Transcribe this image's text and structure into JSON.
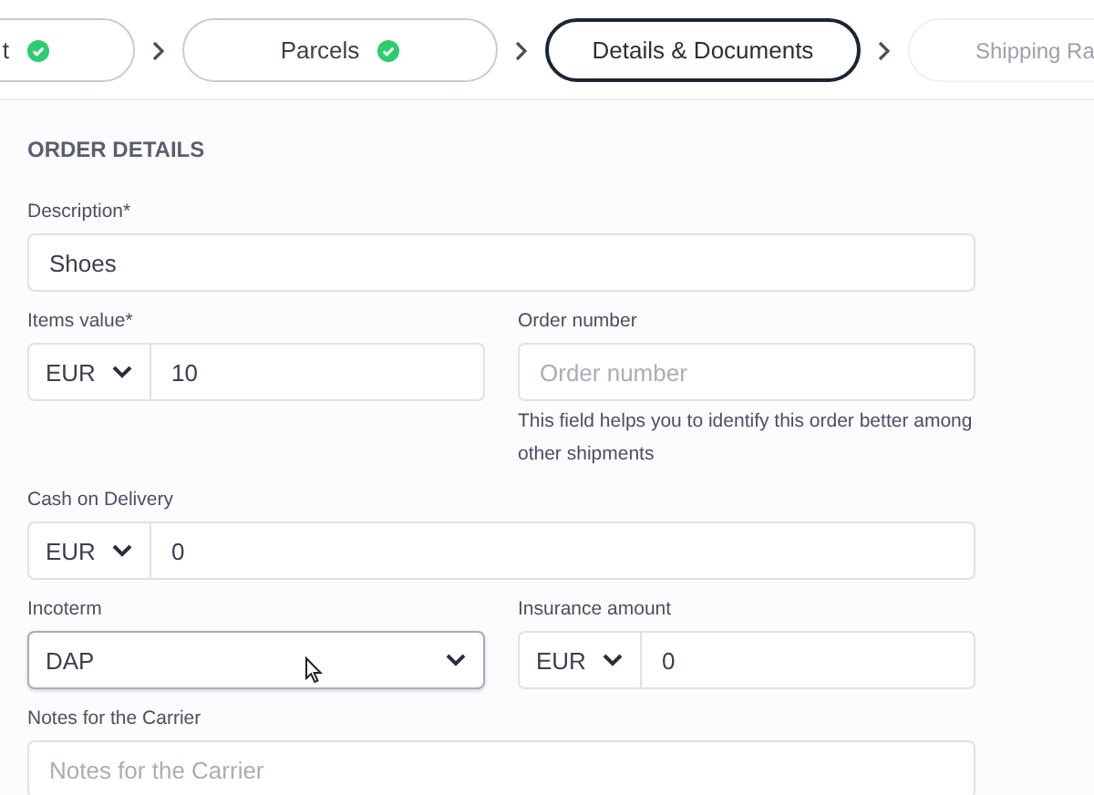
{
  "stepper": [
    {
      "label": "t",
      "kind": "done"
    },
    {
      "label": "Parcels",
      "kind": "done"
    },
    {
      "label": "Details & Documents",
      "kind": "current"
    },
    {
      "label": "Shipping Ra",
      "kind": "upcoming"
    }
  ],
  "section_title": "ORDER DETAILS",
  "rows": [
    [
      {
        "kind": "text",
        "label": "Description*",
        "value": "Shoes"
      }
    ],
    [
      {
        "kind": "currency",
        "label": "Items value*",
        "currency": "EUR",
        "value": "10"
      },
      {
        "kind": "text",
        "label": "Order number",
        "placeholder": "Order number",
        "hint": "This field helps you to identify this order better among other shipments"
      }
    ],
    [
      {
        "kind": "currency",
        "label": "Cash on Delivery",
        "currency": "EUR",
        "value": "0"
      }
    ],
    [
      {
        "kind": "select",
        "label": "Incoterm",
        "value": "DAP",
        "focused": true
      },
      {
        "kind": "currency",
        "label": "Insurance amount",
        "currency": "EUR",
        "value": "0"
      }
    ],
    [
      {
        "kind": "text",
        "label": "Notes for the Carrier",
        "placeholder": "Notes for the Carrier"
      }
    ]
  ]
}
